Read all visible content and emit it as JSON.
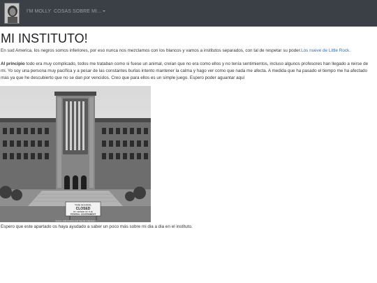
{
  "navbar": {
    "home_label": "I'M MOLLY",
    "dropdown_label": "COSAS SOBRE MI..."
  },
  "page": {
    "title": "MI INSTITUTO!",
    "intro_text": "En sud America, los negros somos inferiores, por eso nunca nos mezclamos con los blancos y vamos a institutos separados, con tal de respetar su poder.",
    "intro_link": "Los nueve de Little Rock.",
    "para_bold": "Al principio",
    "para_text": " todo era muy complicado, todos me trataban como si fuese un animal, creían que no era como ellos y no tenía sentimientos, incluso algunos profesores han llegado a reirse de mi. Yo soy una persona muy pacífica y a pesar de las constantes burlas intento mantener la calma y hago ver como que nada me afecta. A medida que ha pasado el tiempo me ha afectado mas ya que he descubierto que no se dan por vencidos. Creo que para ellos es un simple juego. Espero poder aguantar aquí",
    "closing_text": "Espero que este apartado os haya ayudado a saber un poco más sobre mi dia a dia en el instituto."
  },
  "photo": {
    "sign_line1": "THIS SCHOOL",
    "sign_line2": "CLOSED",
    "sign_line3": "BY ORDER OF THE",
    "sign_line4": "FEDERAL GOVERNMENT",
    "caption": "Source: Hulk Archives and Special Collections"
  },
  "colors": {
    "navbar_bg": "#3b4046",
    "nav_text": "#9d9d9d",
    "link": "#2a6fb8"
  },
  "icons": {
    "avatar": "profile-photo",
    "dropdown": "caret-down-icon"
  }
}
